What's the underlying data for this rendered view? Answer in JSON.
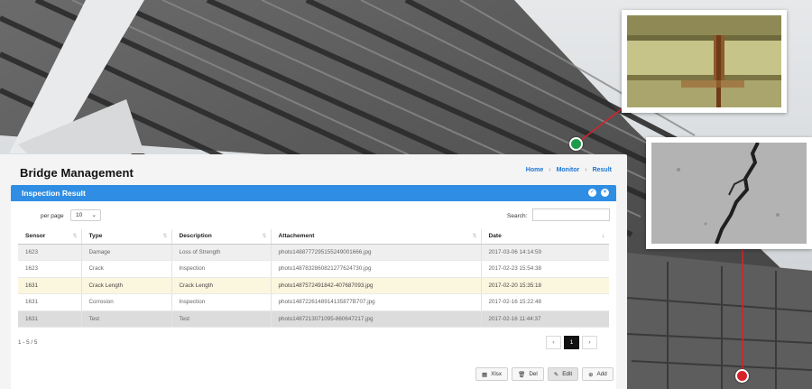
{
  "header": {
    "title": "Bridge Management",
    "breadcrumb": [
      "Home",
      "Monitor",
      "Result"
    ],
    "breadcrumb_sep": "›"
  },
  "card": {
    "title": "Inspection Result"
  },
  "toolbar": {
    "per_page_label": "per page",
    "per_page_value": "10",
    "search_label": "Search:",
    "search_value": ""
  },
  "table": {
    "columns": [
      "Sensor",
      "Type",
      "Description",
      "Attachement",
      "Date"
    ],
    "rows": [
      [
        "1623",
        "Damage",
        "Loss of Strength",
        "photo1488777295155249001666.jpg",
        "2017-03-06 14:14:59"
      ],
      [
        "1623",
        "Crack",
        "Inspection",
        "photo1487832860821277624730.jpg",
        "2017-02-23 15:54:38"
      ],
      [
        "1631",
        "Crack Length",
        "Crack Length",
        "photo1487572491842-407687093.jpg",
        "2017-02-20 15:35:18"
      ],
      [
        "1631",
        "Corrosion",
        "Inspection",
        "photo1487226148914135877B707.jpg",
        "2017-02-16 15:22:48"
      ],
      [
        "1631",
        "Test",
        "Test",
        "photo1487213071095-860647217.jpg",
        "2017-02-16 11:44:37"
      ]
    ]
  },
  "pagination": {
    "info": "1 - 5 / 5",
    "prev": "‹",
    "current": "1",
    "next": "›"
  },
  "actions": {
    "xlsx": "Xlsx",
    "del": "Del",
    "edit": "Edit",
    "add": "Add"
  },
  "colors": {
    "accent": "#2f8ee3",
    "marker_green": "#1f9a4c",
    "marker_red": "#d8222a",
    "highlight_row": "#fbf7df"
  }
}
